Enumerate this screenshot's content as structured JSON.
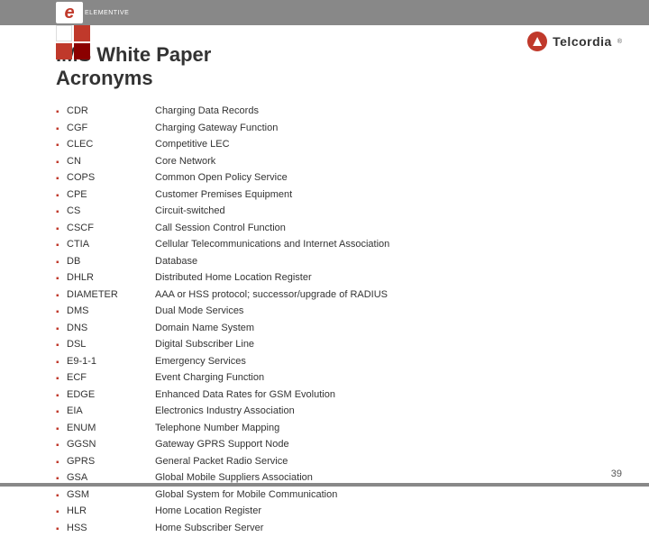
{
  "header": {
    "company": "ELEMENTIVE",
    "logo_letter": "e",
    "brand": "Telcordia"
  },
  "title_line1": "IMS White Paper",
  "title_line2": "Acronyms",
  "acronyms": [
    {
      "key": "CDR",
      "value": "Charging Data Records"
    },
    {
      "key": "CGF",
      "value": "Charging Gateway Function"
    },
    {
      "key": "CLEC",
      "value": "Competitive LEC"
    },
    {
      "key": "CN",
      "value": "Core Network"
    },
    {
      "key": "COPS",
      "value": "Common Open Policy Service"
    },
    {
      "key": "CPE",
      "value": "Customer Premises Equipment"
    },
    {
      "key": "CS",
      "value": "Circuit-switched"
    },
    {
      "key": "CSCF",
      "value": "Call Session Control Function"
    },
    {
      "key": "CTIA",
      "value": "Cellular Telecommunications and Internet Association"
    },
    {
      "key": "DB",
      "value": "Database"
    },
    {
      "key": "DHLR",
      "value": "Distributed Home Location Register"
    },
    {
      "key": "DIAMETER",
      "value": "AAA or HSS protocol; successor/upgrade of RADIUS"
    },
    {
      "key": "DMS",
      "value": "Dual Mode Services"
    },
    {
      "key": "DNS",
      "value": "Domain Name System"
    },
    {
      "key": "DSL",
      "value": "Digital Subscriber Line"
    },
    {
      "key": "E9-1-1",
      "value": "Emergency Services"
    },
    {
      "key": "ECF",
      "value": "Event Charging Function"
    },
    {
      "key": "EDGE",
      "value": "Enhanced Data Rates for GSM Evolution"
    },
    {
      "key": "EIA",
      "value": "Electronics Industry Association"
    },
    {
      "key": "ENUM",
      "value": "Telephone Number Mapping"
    },
    {
      "key": "GGSN",
      "value": "Gateway GPRS Support Node"
    },
    {
      "key": "GPRS",
      "value": "General Packet Radio Service"
    },
    {
      "key": "GSA",
      "value": "Global Mobile Suppliers Association"
    },
    {
      "key": "GSM",
      "value": "Global System for Mobile Communication"
    },
    {
      "key": "HLR",
      "value": "Home Location Register"
    },
    {
      "key": "HSS",
      "value": "Home Subscriber Server"
    }
  ],
  "page_number": "39"
}
